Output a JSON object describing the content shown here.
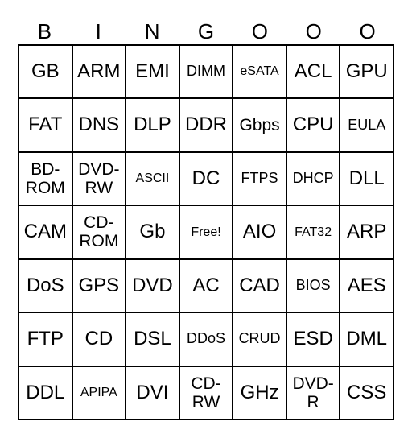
{
  "header": [
    "B",
    "I",
    "N",
    "G",
    "O",
    "O",
    "O"
  ],
  "cells": [
    [
      "GB",
      "ARM",
      "EMI",
      "DIMM",
      "eSATA",
      "ACL",
      "GPU"
    ],
    [
      "FAT",
      "DNS",
      "DLP",
      "DDR",
      "Gbps",
      "CPU",
      "EULA"
    ],
    [
      "BD-\nROM",
      "DVD-\nRW",
      "ASCII",
      "DC",
      "FTPS",
      "DHCP",
      "DLL"
    ],
    [
      "CAM",
      "CD-\nROM",
      "Gb",
      "Free!",
      "AIO",
      "FAT32",
      "ARP"
    ],
    [
      "DoS",
      "GPS",
      "DVD",
      "AC",
      "CAD",
      "BIOS",
      "AES"
    ],
    [
      "FTP",
      "CD",
      "DSL",
      "DDoS",
      "CRUD",
      "ESD",
      "DML"
    ],
    [
      "DDL",
      "APIPA",
      "DVI",
      "CD-\nRW",
      "GHz",
      "DVD-\nR",
      "CSS"
    ]
  ]
}
